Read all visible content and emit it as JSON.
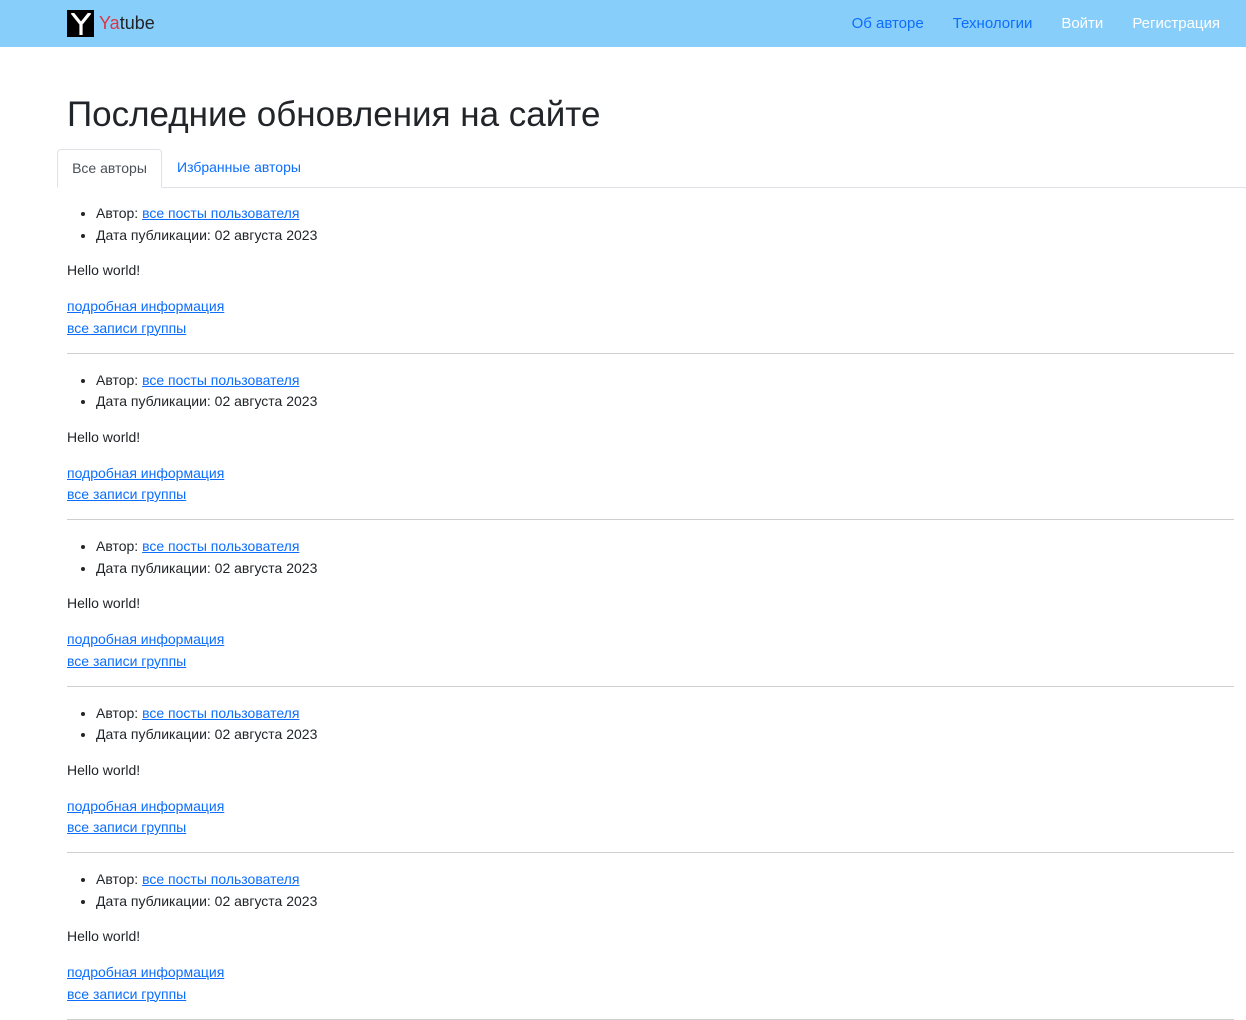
{
  "navbar": {
    "brand_accent": "Ya",
    "brand_rest": "tube",
    "logo_letter": "Y",
    "links": [
      {
        "label": "Об авторе",
        "color": "#0d6efd"
      },
      {
        "label": "Технологии",
        "color": "#0d6efd"
      },
      {
        "label": "Войти",
        "color": "#ffffff"
      },
      {
        "label": "Регистрация",
        "color": "#ffffff"
      }
    ],
    "background": "#87cefa"
  },
  "page_title": "Последние обновления на сайте",
  "tabs": [
    {
      "label": "Все авторы",
      "active": true
    },
    {
      "label": "Избранные авторы",
      "active": false
    }
  ],
  "posts": [
    {
      "author_label": "Автор:",
      "author_link": "все посты пользователя",
      "date_label": "Дата публикации:",
      "date": "02 августа 2023",
      "text": "Hello world!",
      "detail_link": "подробная информация",
      "group_link": "все записи группы"
    },
    {
      "author_label": "Автор:",
      "author_link": "все посты пользователя",
      "date_label": "Дата публикации:",
      "date": "02 августа 2023",
      "text": "Hello world!",
      "detail_link": "подробная информация",
      "group_link": "все записи группы"
    },
    {
      "author_label": "Автор:",
      "author_link": "все посты пользователя",
      "date_label": "Дата публикации:",
      "date": "02 августа 2023",
      "text": "Hello world!",
      "detail_link": "подробная информация",
      "group_link": "все записи группы"
    },
    {
      "author_label": "Автор:",
      "author_link": "все посты пользователя",
      "date_label": "Дата публикации:",
      "date": "02 августа 2023",
      "text": "Hello world!",
      "detail_link": "подробная информация",
      "group_link": "все записи группы"
    },
    {
      "author_label": "Автор:",
      "author_link": "все посты пользователя",
      "date_label": "Дата публикации:",
      "date": "02 августа 2023",
      "text": "Hello world!",
      "detail_link": "подробная информация",
      "group_link": "все записи группы"
    }
  ]
}
